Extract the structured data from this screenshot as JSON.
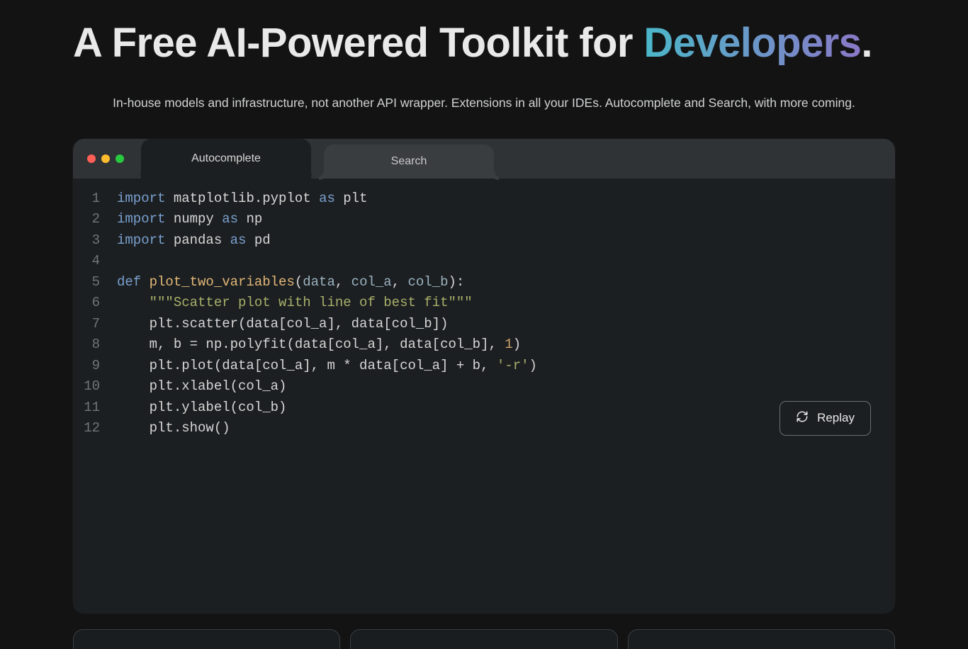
{
  "hero": {
    "title_plain": "A Free AI-Powered Toolkit for ",
    "title_accent": "Developers",
    "title_dot": "."
  },
  "subtitle": "In-house models and infrastructure, not another API wrapper. Extensions in all your IDEs. Autocomplete and Search, with more coming.",
  "tabs": [
    {
      "label": "Autocomplete",
      "active": true
    },
    {
      "label": "Search",
      "active": false
    }
  ],
  "replay_label": "Replay",
  "code": {
    "lines": [
      [
        {
          "t": "kw",
          "v": "import"
        },
        {
          "t": "",
          "v": " matplotlib.pyplot "
        },
        {
          "t": "kw",
          "v": "as"
        },
        {
          "t": "",
          "v": " plt"
        }
      ],
      [
        {
          "t": "kw",
          "v": "import"
        },
        {
          "t": "",
          "v": " numpy "
        },
        {
          "t": "kw",
          "v": "as"
        },
        {
          "t": "",
          "v": " np"
        }
      ],
      [
        {
          "t": "kw",
          "v": "import"
        },
        {
          "t": "",
          "v": " pandas "
        },
        {
          "t": "kw",
          "v": "as"
        },
        {
          "t": "",
          "v": " pd"
        }
      ],
      [],
      [
        {
          "t": "kw",
          "v": "def "
        },
        {
          "t": "fn",
          "v": "plot_two_variables"
        },
        {
          "t": "",
          "v": "("
        },
        {
          "t": "par",
          "v": "data"
        },
        {
          "t": "",
          "v": ", "
        },
        {
          "t": "par",
          "v": "col_a"
        },
        {
          "t": "",
          "v": ", "
        },
        {
          "t": "par",
          "v": "col_b"
        },
        {
          "t": "",
          "v": "):"
        }
      ],
      [
        {
          "t": "",
          "v": "    "
        },
        {
          "t": "str",
          "v": "\"\"\"Scatter plot with line of best fit\"\"\""
        }
      ],
      [
        {
          "t": "",
          "v": "    plt.scatter(data[col_a], data[col_b])"
        }
      ],
      [
        {
          "t": "",
          "v": "    m, b = np.polyfit(data[col_a], data[col_b], "
        },
        {
          "t": "num",
          "v": "1"
        },
        {
          "t": "",
          "v": ")"
        }
      ],
      [
        {
          "t": "",
          "v": "    plt.plot(data[col_a], m * data[col_a] + b, "
        },
        {
          "t": "str",
          "v": "'-r'"
        },
        {
          "t": "",
          "v": ")"
        }
      ],
      [
        {
          "t": "",
          "v": "    plt.xlabel(col_a)"
        }
      ],
      [
        {
          "t": "",
          "v": "    plt.ylabel(col_b)"
        }
      ],
      [
        {
          "t": "",
          "v": "    plt.show()"
        }
      ]
    ]
  }
}
